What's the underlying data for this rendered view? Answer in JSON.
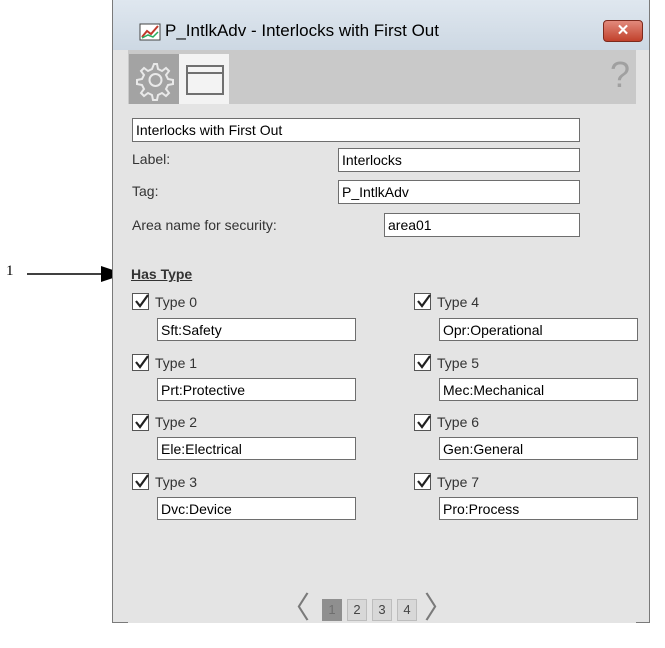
{
  "callout": {
    "number": "1"
  },
  "window": {
    "title": "P_IntlkAdv - Interlocks with First Out",
    "close_label": "✕"
  },
  "toolbar": {
    "tabs": [
      {
        "icon": "gear-icon"
      },
      {
        "icon": "faceplate-icon"
      }
    ],
    "help_label": "?"
  },
  "form": {
    "description": "Interlocks with First Out",
    "label_caption": "Label:",
    "label_value": "Interlocks",
    "tag_caption": "Tag:",
    "tag_value": "P_IntlkAdv",
    "area_caption": "Area name for security:",
    "area_value": "area01"
  },
  "has_type": {
    "title": "Has Type",
    "types": [
      {
        "label": "Type 0",
        "value": "Sft:Safety",
        "checked": true
      },
      {
        "label": "Type 1",
        "value": "Prt:Protective",
        "checked": true
      },
      {
        "label": "Type 2",
        "value": "Ele:Electrical",
        "checked": true
      },
      {
        "label": "Type 3",
        "value": "Dvc:Device",
        "checked": true
      },
      {
        "label": "Type 4",
        "value": "Opr:Operational",
        "checked": true
      },
      {
        "label": "Type 5",
        "value": "Mec:Mechanical",
        "checked": true
      },
      {
        "label": "Type 6",
        "value": "Gen:General",
        "checked": true
      },
      {
        "label": "Type 7",
        "value": "Pro:Process",
        "checked": true
      }
    ]
  },
  "pager": {
    "prev": "〈",
    "next": "〉",
    "pages": [
      "1",
      "2",
      "3",
      "4"
    ],
    "current": "1"
  }
}
